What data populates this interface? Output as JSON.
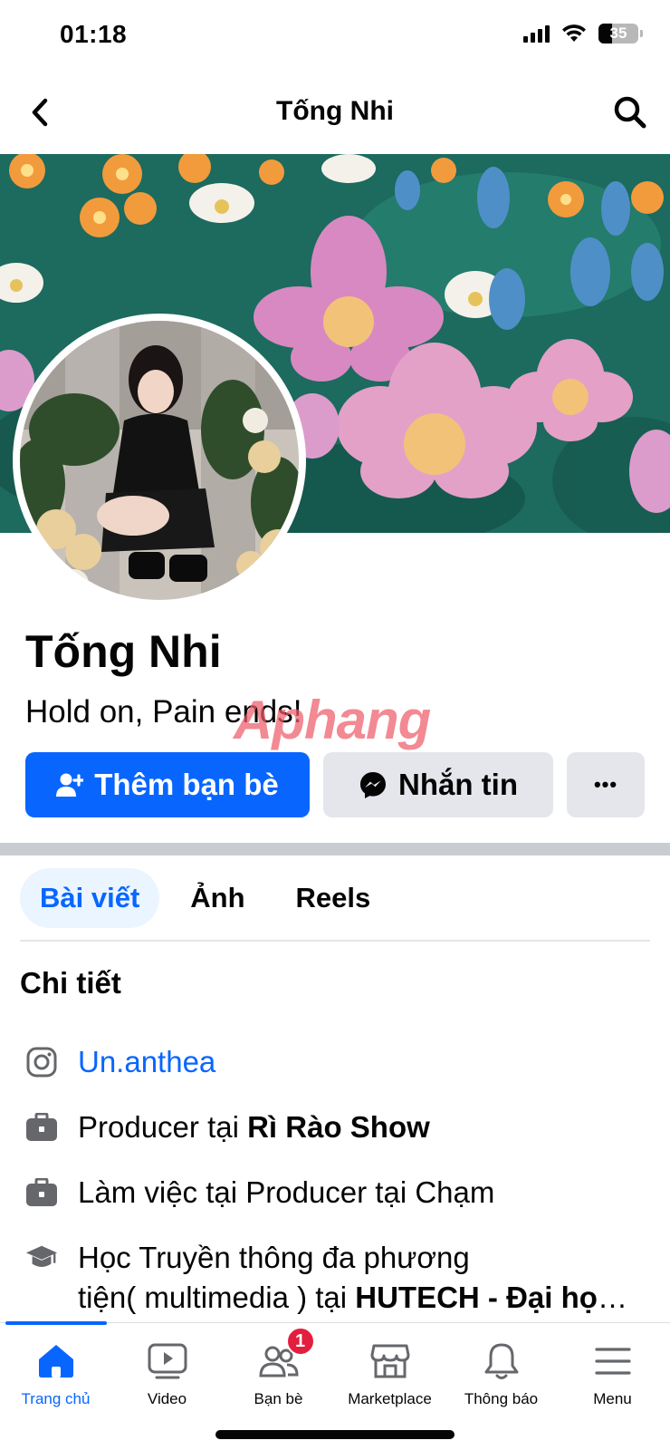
{
  "status_bar": {
    "time": "01:18",
    "battery_level": "35"
  },
  "header": {
    "title": "Tống Nhi"
  },
  "profile": {
    "name": "Tống Nhi",
    "bio": "Hold on, Pain ends!",
    "watermark": "Aphang"
  },
  "actions": {
    "add_friend": "Thêm bạn bè",
    "message": "Nhắn tin",
    "more": "•••"
  },
  "tabs": [
    {
      "label": "Bài viết",
      "active": true
    },
    {
      "label": "Ảnh",
      "active": false
    },
    {
      "label": "Reels",
      "active": false
    }
  ],
  "details": {
    "title": "Chi tiết",
    "instagram": "Un.anthea",
    "job1_prefix": "Producer tại ",
    "job1_place": "Rì Rào Show",
    "job2": "Làm việc tại Producer tại Chạm",
    "edu_line1": "Học Truyền thông đa phương",
    "edu_line2_prefix": "tiện( multimedia ) tại ",
    "edu_line2_place": "HUTECH - Đại học Công nghệ TP.HCM"
  },
  "bottom_nav": [
    {
      "label": "Trang chủ",
      "icon": "home-icon",
      "active": true
    },
    {
      "label": "Video",
      "icon": "video-icon",
      "active": false
    },
    {
      "label": "Bạn bè",
      "icon": "friends-icon",
      "active": false,
      "badge": "1"
    },
    {
      "label": "Marketplace",
      "icon": "marketplace-icon",
      "active": false
    },
    {
      "label": "Thông báo",
      "icon": "bell-icon",
      "active": false
    },
    {
      "label": "Menu",
      "icon": "menu-icon",
      "active": false
    }
  ],
  "colors": {
    "accent": "#0866ff",
    "badge": "#e41e3f",
    "button_gray": "#e4e6eb"
  }
}
